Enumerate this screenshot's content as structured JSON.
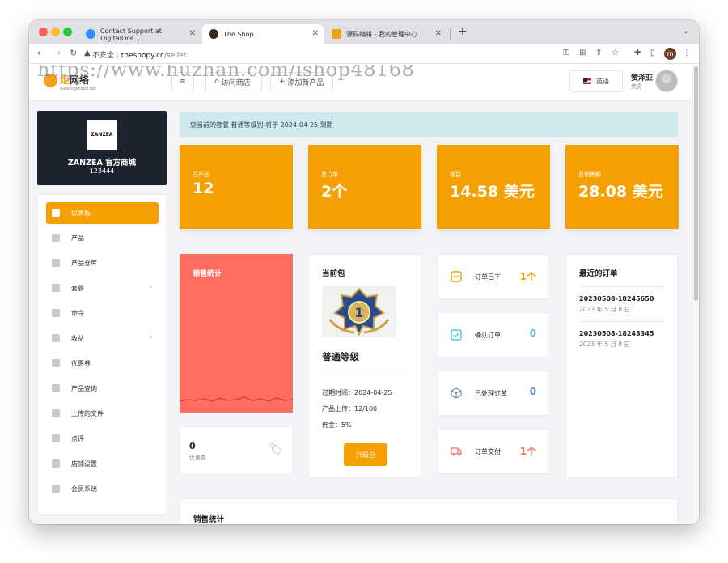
{
  "browser": {
    "tabs": [
      {
        "title": "Contact Support at DigitalOce...",
        "favicon_color": "#2d8cff"
      },
      {
        "title": "The Shop",
        "favicon_color": "#3a2a1a"
      },
      {
        "title": "源码编辑 - 我的管理中心",
        "favicon_color": "#f0a020"
      }
    ],
    "url_security": "不安全",
    "url_host": "theshopy.cc",
    "url_path": "/seller",
    "profile_initial": "m"
  },
  "watermark": "https://www.huzhan.com/ishop48168",
  "header": {
    "logo_text": "炬",
    "logo_text_dark": "网络",
    "logo_sub": "www.tigshopit.net",
    "visit_label": "访问商店",
    "add_label": "添加新产品",
    "language": "英语",
    "user_name": "赞泽亚",
    "user_role": "卖方"
  },
  "shop": {
    "logo_text": "ZANZEA",
    "name": "ZANZEA 官方商城",
    "id": "123444"
  },
  "menu": [
    {
      "label": "仪表板",
      "active": true,
      "chevron": false
    },
    {
      "label": "产品",
      "active": false,
      "chevron": false
    },
    {
      "label": "产品仓库",
      "active": false,
      "chevron": false
    },
    {
      "label": "套餐",
      "active": false,
      "chevron": true
    },
    {
      "label": "命令",
      "active": false,
      "chevron": false
    },
    {
      "label": "收益",
      "active": false,
      "chevron": true
    },
    {
      "label": "优惠券",
      "active": false,
      "chevron": false
    },
    {
      "label": "产品查询",
      "active": false,
      "chevron": false
    },
    {
      "label": "上传的文件",
      "active": false,
      "chevron": false
    },
    {
      "label": "点评",
      "active": false,
      "chevron": false
    },
    {
      "label": "店铺设置",
      "active": false,
      "chevron": false
    },
    {
      "label": "会员系统",
      "active": false,
      "chevron": false
    }
  ],
  "notice": "您当前的套餐 普通等级别 将于 2024-04-25 到期",
  "stats": [
    {
      "label": "总产品",
      "value": "12"
    },
    {
      "label": "总订单",
      "value": "2个"
    },
    {
      "label": "收益",
      "value": "14.58 美元"
    },
    {
      "label": "总销售额",
      "value": "28.08 美元"
    }
  ],
  "sales_title": "销售统计",
  "coupon": {
    "count": "0",
    "label": "优惠券"
  },
  "package": {
    "title": "当前包",
    "name": "普通等级",
    "expiry": "过期时间：2024-04-25",
    "uploads": "产品上传：12/100",
    "commission": "佣金：5%",
    "upgrade_label": "升级包"
  },
  "order_status": [
    {
      "label": "订单已下",
      "value": "1个",
      "color": "#f5a000"
    },
    {
      "label": "确认订单",
      "value": "0",
      "color": "#5bc0de"
    },
    {
      "label": "已处理订单",
      "value": "0",
      "color": "#6c8ebf"
    },
    {
      "label": "订单交付",
      "value": "1个",
      "color": "#ff6d61"
    }
  ],
  "recent_orders": {
    "title": "最近的订单",
    "items": [
      {
        "code": "20230508-18245650",
        "date": "2023 年 5 月 8 日"
      },
      {
        "code": "20230508-18243345",
        "date": "2023 年 5 月 8 日"
      }
    ]
  },
  "bottom_title": "销售统计"
}
